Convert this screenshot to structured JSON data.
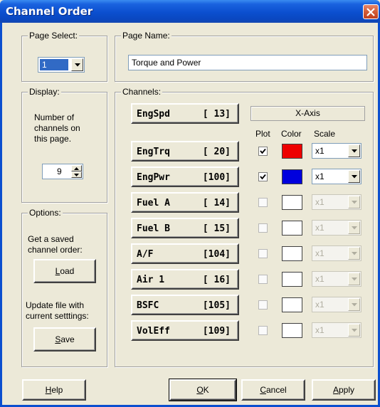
{
  "window": {
    "title": "Channel Order"
  },
  "page_select": {
    "label": "Page Select:",
    "value": "1"
  },
  "page_name": {
    "label": "Page Name:",
    "value": "Torque and Power"
  },
  "display": {
    "label": "Display:",
    "line1": "Number of",
    "line2": "channels on",
    "line3": "this page.",
    "count": "9"
  },
  "options": {
    "label": "Options:",
    "load_text1": "Get a saved",
    "load_text2": "channel order:",
    "load_first": "L",
    "load_rest": "oad",
    "save_text1": "Update file with",
    "save_text2": "current setttings:",
    "save_first": "S",
    "save_rest": "ave"
  },
  "channels": {
    "label": "Channels:",
    "x_axis_label": "X-Axis",
    "col_plot": "Plot",
    "col_color": "Color",
    "col_scale": "Scale",
    "x_axis_channel": {
      "name": "EngSpd",
      "num": "[ 13]"
    },
    "rows": [
      {
        "name": "EngTrq",
        "num": "[ 20]",
        "plot": true,
        "color": "#ee0000",
        "scale": "x1",
        "enabled": true
      },
      {
        "name": "EngPwr",
        "num": "[100]",
        "plot": true,
        "color": "#0000dd",
        "scale": "x1",
        "enabled": true
      },
      {
        "name": "Fuel A",
        "num": "[ 14]",
        "plot": false,
        "color": "#ffffff",
        "scale": "x1",
        "enabled": false
      },
      {
        "name": "Fuel B",
        "num": "[ 15]",
        "plot": false,
        "color": "#ffffff",
        "scale": "x1",
        "enabled": false
      },
      {
        "name": "A/F",
        "num": "[104]",
        "plot": false,
        "color": "#ffffff",
        "scale": "x1",
        "enabled": false
      },
      {
        "name": "Air 1",
        "num": "[ 16]",
        "plot": false,
        "color": "#ffffff",
        "scale": "x1",
        "enabled": false
      },
      {
        "name": "BSFC",
        "num": "[105]",
        "plot": false,
        "color": "#ffffff",
        "scale": "x1",
        "enabled": false
      },
      {
        "name": "VolEff",
        "num": "[109]",
        "plot": false,
        "color": "#ffffff",
        "scale": "x1",
        "enabled": false
      }
    ]
  },
  "buttons": {
    "help_first": "H",
    "help_rest": "elp",
    "ok_first": "O",
    "ok_rest": "K",
    "cancel_first": "C",
    "cancel_rest": "ancel",
    "apply_first": "A",
    "apply_rest": "pply"
  }
}
